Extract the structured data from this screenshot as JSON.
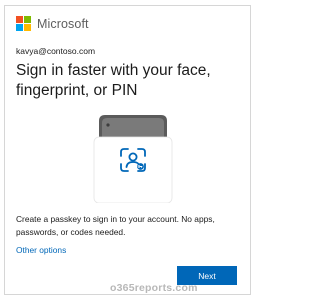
{
  "brand": {
    "name": "Microsoft",
    "logo_colors": [
      "#f25022",
      "#7fba00",
      "#00a4ef",
      "#ffb900"
    ]
  },
  "account": {
    "email": "kavya@contoso.com"
  },
  "heading": "Sign in faster with your face, fingerprint, or PIN",
  "illustration": {
    "icon": "passkey-face-scan-icon"
  },
  "description": "Create a passkey to sign in to your account. No apps, passwords, or codes needed.",
  "links": {
    "other_options": "Other options"
  },
  "buttons": {
    "next": "Next"
  },
  "watermark": "o365reports.com",
  "colors": {
    "accent": "#0067b8",
    "text": "#1b1b1b"
  }
}
